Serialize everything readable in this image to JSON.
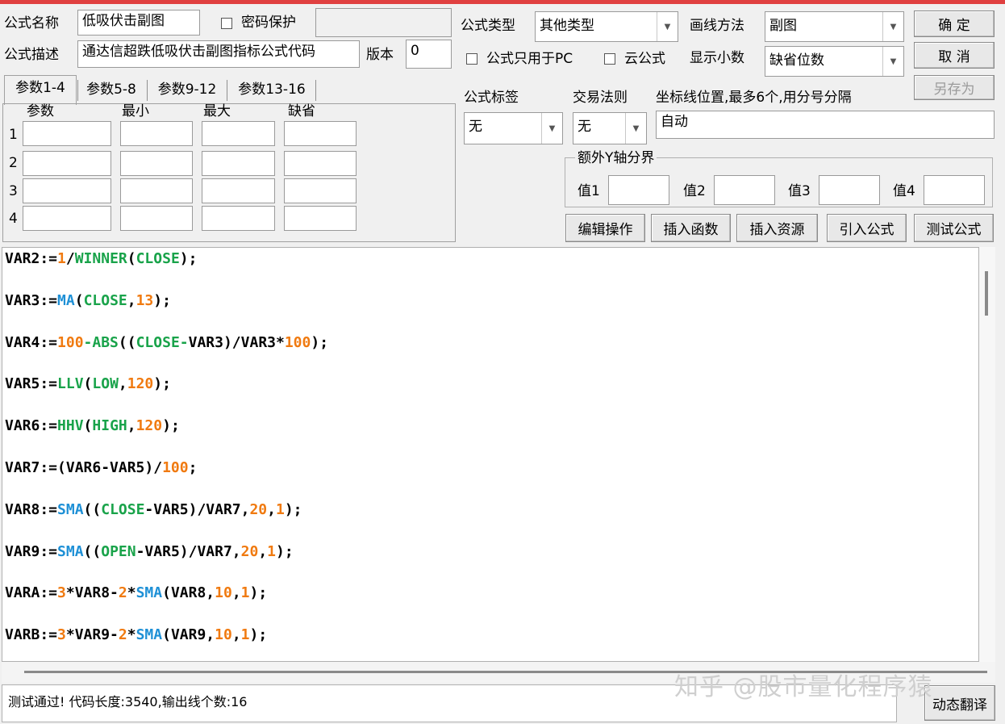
{
  "window": {
    "accent_color": "#e04040"
  },
  "form": {
    "name_label": "公式名称",
    "name_value": "低吸伏击副图",
    "password_label": "密码保护",
    "password_value": "",
    "desc_label": "公式描述",
    "desc_value": "通达信超跌低吸伏击副图指标公式代码",
    "version_label": "版本",
    "version_value": "0",
    "type_label": "公式类型",
    "type_value": "其他类型",
    "draw_label": "画线方法",
    "draw_value": "副图",
    "pc_only_label": "公式只用于PC",
    "cloud_label": "云公式",
    "decimal_label": "显示小数",
    "decimal_value": "缺省位数",
    "tag_label": "公式标签",
    "tag_value": "无",
    "rule_label": "交易法则",
    "rule_value": "无",
    "axis_label": "坐标线位置,最多6个,用分号分隔",
    "axis_value": "自动"
  },
  "buttons": {
    "ok": "确  定",
    "cancel": "取  消",
    "save_as": "另存为",
    "edit_ops": "编辑操作",
    "insert_func": "插入函数",
    "insert_res": "插入资源",
    "import_formula": "引入公式",
    "test_formula": "测试公式",
    "dynamic_translate": "动态翻译"
  },
  "tabs": [
    "参数1-4",
    "参数5-8",
    "参数9-12",
    "参数13-16"
  ],
  "params": {
    "headers": [
      "参数",
      "最小",
      "最大",
      "缺省"
    ],
    "rows": [
      "1",
      "2",
      "3",
      "4"
    ]
  },
  "y_axis": {
    "group_label": "额外Y轴分界",
    "labels": [
      "值1",
      "值2",
      "值3",
      "值4"
    ]
  },
  "code_lines": [
    [
      [
        "d",
        "VAR2:="
      ],
      [
        "n",
        "1"
      ],
      [
        "d",
        "/"
      ],
      [
        "f",
        "WINNER"
      ],
      [
        "d",
        "("
      ],
      [
        "f",
        "CLOSE"
      ],
      [
        "d",
        ");"
      ]
    ],
    [
      [
        "d",
        "VAR3:="
      ],
      [
        "b",
        "MA"
      ],
      [
        "d",
        "("
      ],
      [
        "f",
        "CLOSE"
      ],
      [
        "d",
        ","
      ],
      [
        "n",
        "13"
      ],
      [
        "d",
        ");"
      ]
    ],
    [
      [
        "d",
        "VAR4:="
      ],
      [
        "n",
        "100"
      ],
      [
        "f",
        "-ABS"
      ],
      [
        "d",
        "(("
      ],
      [
        "f",
        "CLOSE"
      ],
      [
        "f",
        "-"
      ],
      [
        "d",
        "VAR3)/VAR3*"
      ],
      [
        "n",
        "100"
      ],
      [
        "d",
        ");"
      ]
    ],
    [
      [
        "d",
        "VAR5:="
      ],
      [
        "f",
        "LLV"
      ],
      [
        "d",
        "("
      ],
      [
        "f",
        "LOW"
      ],
      [
        "d",
        ","
      ],
      [
        "n",
        "120"
      ],
      [
        "d",
        ");"
      ]
    ],
    [
      [
        "d",
        "VAR6:="
      ],
      [
        "f",
        "HHV"
      ],
      [
        "d",
        "("
      ],
      [
        "f",
        "HIGH"
      ],
      [
        "d",
        ","
      ],
      [
        "n",
        "120"
      ],
      [
        "d",
        ");"
      ]
    ],
    [
      [
        "d",
        "VAR7:=(VAR6-VAR5)/"
      ],
      [
        "n",
        "100"
      ],
      [
        "d",
        ";"
      ]
    ],
    [
      [
        "d",
        "VAR8:="
      ],
      [
        "b",
        "SMA"
      ],
      [
        "d",
        "(("
      ],
      [
        "f",
        "CLOSE"
      ],
      [
        "d",
        "-VAR5)/VAR7,"
      ],
      [
        "n",
        "20"
      ],
      [
        "d",
        ","
      ],
      [
        "n",
        "1"
      ],
      [
        "d",
        ");"
      ]
    ],
    [
      [
        "d",
        "VAR9:="
      ],
      [
        "b",
        "SMA"
      ],
      [
        "d",
        "(("
      ],
      [
        "f",
        "OPEN"
      ],
      [
        "d",
        "-VAR5)/VAR7,"
      ],
      [
        "n",
        "20"
      ],
      [
        "d",
        ","
      ],
      [
        "n",
        "1"
      ],
      [
        "d",
        ");"
      ]
    ],
    [
      [
        "d",
        "VARA:="
      ],
      [
        "n",
        "3"
      ],
      [
        "d",
        "*VAR8-"
      ],
      [
        "n",
        "2"
      ],
      [
        "d",
        "*"
      ],
      [
        "b",
        "SMA"
      ],
      [
        "d",
        "(VAR8,"
      ],
      [
        "n",
        "10"
      ],
      [
        "d",
        ","
      ],
      [
        "n",
        "1"
      ],
      [
        "d",
        ");"
      ]
    ],
    [
      [
        "d",
        "VARB:="
      ],
      [
        "n",
        "3"
      ],
      [
        "d",
        "*VAR9-"
      ],
      [
        "n",
        "2"
      ],
      [
        "d",
        "*"
      ],
      [
        "b",
        "SMA"
      ],
      [
        "d",
        "(VAR9,"
      ],
      [
        "n",
        "10"
      ],
      [
        "d",
        ","
      ],
      [
        "n",
        "1"
      ],
      [
        "d",
        ");"
      ]
    ]
  ],
  "status": {
    "text": "测试通过! 代码长度:3540,输出线个数:16"
  },
  "watermark": "知乎 @股市量化程序猿"
}
